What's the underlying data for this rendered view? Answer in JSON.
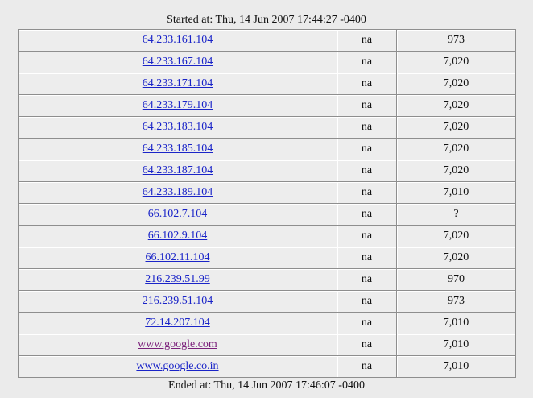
{
  "header": {
    "started": "Started at: Thu, 14 Jun 2007 17:44:27 -0400"
  },
  "footer": {
    "ended": "Ended at: Thu, 14 Jun 2007 17:46:07 -0400"
  },
  "colors": {
    "link": "#1a24c8",
    "visited_link": "#7a1f7a",
    "background": "#ebebeb"
  },
  "rows": [
    {
      "host": "64.233.161.104",
      "status": "na",
      "value": "973"
    },
    {
      "host": "64.233.167.104",
      "status": "na",
      "value": "7,020"
    },
    {
      "host": "64.233.171.104",
      "status": "na",
      "value": "7,020"
    },
    {
      "host": "64.233.179.104",
      "status": "na",
      "value": "7,020"
    },
    {
      "host": "64.233.183.104",
      "status": "na",
      "value": "7,020"
    },
    {
      "host": "64.233.185.104",
      "status": "na",
      "value": "7,020"
    },
    {
      "host": "64.233.187.104",
      "status": "na",
      "value": "7,020"
    },
    {
      "host": "64.233.189.104",
      "status": "na",
      "value": "7,010"
    },
    {
      "host": "66.102.7.104",
      "status": "na",
      "value": "?"
    },
    {
      "host": "66.102.9.104",
      "status": "na",
      "value": "7,020"
    },
    {
      "host": "66.102.11.104",
      "status": "na",
      "value": "7,020"
    },
    {
      "host": "216.239.51.99",
      "status": "na",
      "value": "970"
    },
    {
      "host": "216.239.51.104",
      "status": "na",
      "value": "973"
    },
    {
      "host": "72.14.207.104",
      "status": "na",
      "value": "7,010"
    },
    {
      "host": "www.google.com",
      "status": "na",
      "value": "7,010",
      "visited": true
    },
    {
      "host": "www.google.co.in",
      "status": "na",
      "value": "7,010"
    }
  ]
}
